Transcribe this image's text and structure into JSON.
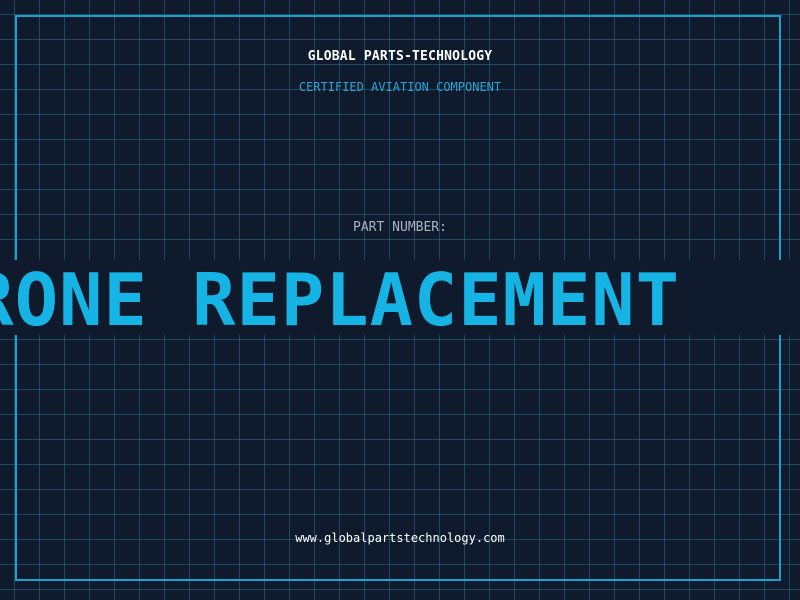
{
  "header": {
    "company": "GLOBAL PARTS-TECHNOLOGY",
    "tagline": "CERTIFIED AVIATION COMPONENT"
  },
  "part": {
    "label": "PART NUMBER:",
    "value": "UNDER DRONE REPLACEMENT"
  },
  "footer": {
    "website": "www.globalpartstechnology.com"
  },
  "colors": {
    "background": "#0f1a2c",
    "grid": "#266e8c",
    "frame": "#1aa0cc",
    "accent": "#16b4e4",
    "label": "#a9b4c6",
    "text": "#ffffff"
  }
}
